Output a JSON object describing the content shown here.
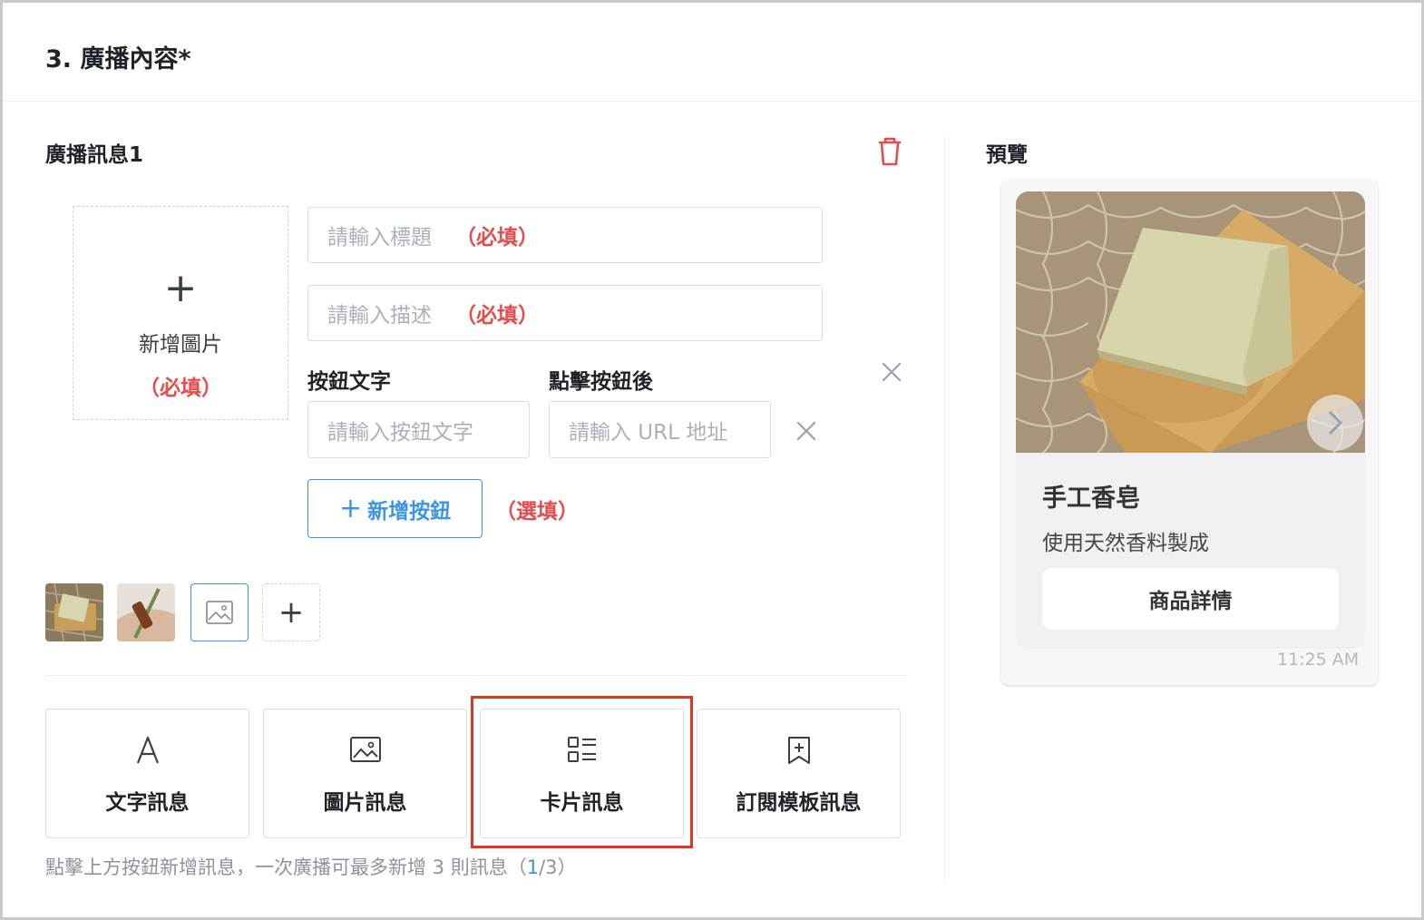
{
  "section": {
    "title": "3. 廣播內容*"
  },
  "message": {
    "title": "廣播訊息1",
    "image_upload": {
      "label": "新增圖片",
      "required": "（必填）"
    },
    "title_input": {
      "placeholder": "請輸入標題",
      "required": "（必填）"
    },
    "desc_input": {
      "placeholder": "請輸入描述",
      "required": "（必填）"
    },
    "button_text_label": "按鈕文字",
    "after_click_label": "點擊按鈕後",
    "button_text_input": {
      "placeholder": "請輸入按鈕文字"
    },
    "url_input": {
      "placeholder": "請輸入 URL 地址"
    },
    "add_button": {
      "label": "新增按鈕",
      "optional": "（選填）"
    }
  },
  "message_types": [
    {
      "label": "文字訊息",
      "icon": "letter-a-icon"
    },
    {
      "label": "圖片訊息",
      "icon": "image-icon"
    },
    {
      "label": "卡片訊息",
      "icon": "card-list-icon"
    },
    {
      "label": "訂閱模板訊息",
      "icon": "bookmark-plus-icon"
    }
  ],
  "hint": {
    "text": "點擊上方按鈕新增訊息，一次廣播可最多新增 3 則訊息（",
    "current": "1",
    "rest": "/3）"
  },
  "preview": {
    "title": "預覽",
    "card_title": "手工香皂",
    "card_desc": "使用天然香料製成",
    "card_button": "商品詳情",
    "time": "11:25 AM"
  },
  "colors": {
    "accent": "#3b95e6",
    "required": "#e84b4b",
    "highlight": "#e33226"
  }
}
